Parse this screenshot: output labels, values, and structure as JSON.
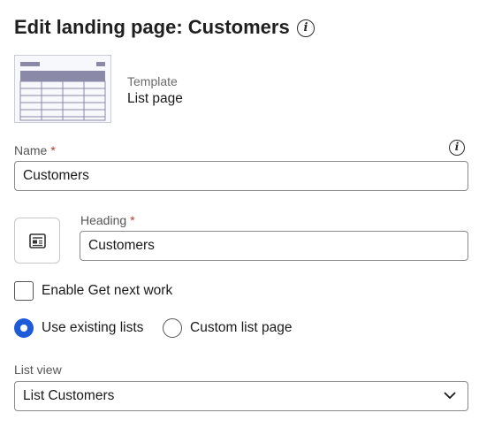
{
  "header": {
    "title": "Edit landing page: Customers",
    "info_icon": "info-icon"
  },
  "template": {
    "label": "Template",
    "value": "List page",
    "thumbnail_icon": "list-table-thumbnail"
  },
  "name_field": {
    "label": "Name",
    "required_mark": "*",
    "value": "Customers",
    "info_icon": "info-icon"
  },
  "heading_field": {
    "label": "Heading",
    "required_mark": "*",
    "value": "Customers",
    "icon": "page-icon"
  },
  "options": {
    "get_next_work": {
      "label": "Enable Get next work",
      "checked": false
    },
    "list_mode": [
      {
        "label": "Use existing lists",
        "selected": true
      },
      {
        "label": "Custom list page",
        "selected": false
      }
    ]
  },
  "list_view": {
    "label": "List view",
    "value": "List Customers",
    "chevron_icon": "chevron-down-icon"
  },
  "colors": {
    "accent": "#1e5bd8",
    "required": "#c0392b",
    "thumbnail_header": "#8a8aa8"
  }
}
